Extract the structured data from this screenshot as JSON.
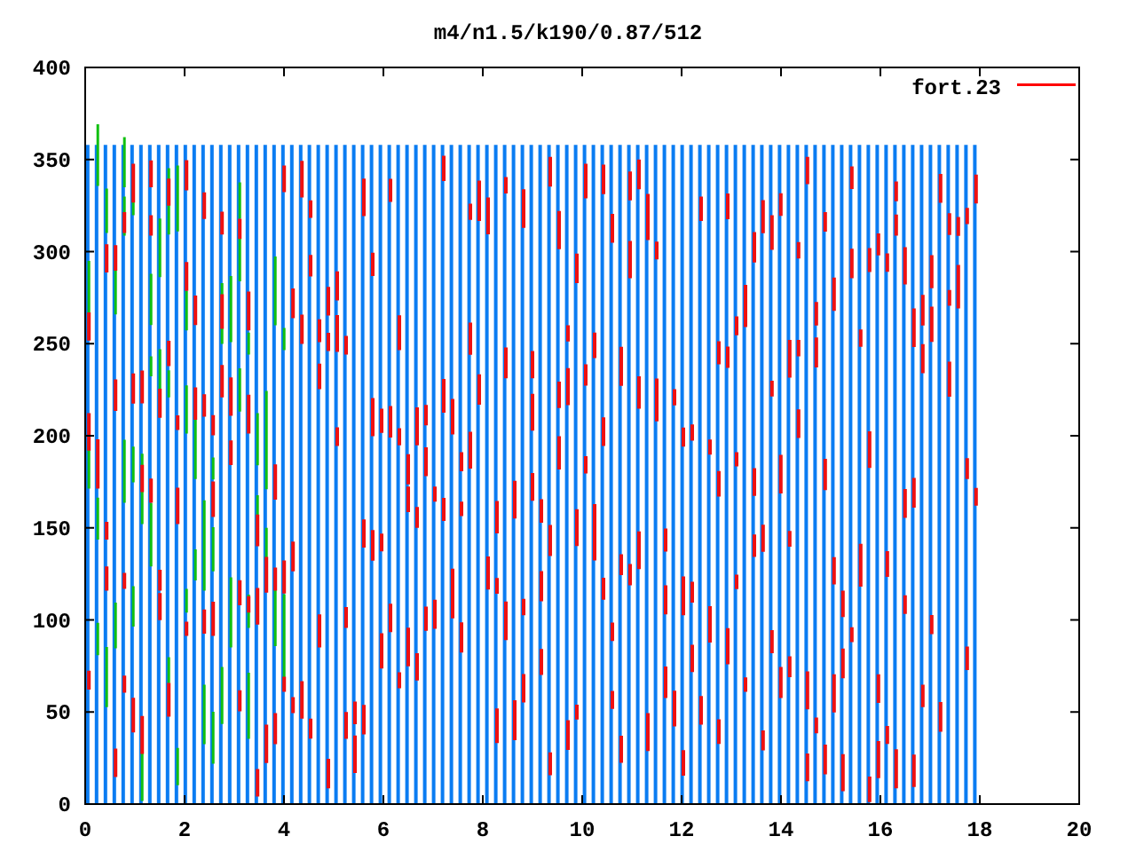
{
  "plot": {
    "title": "m4/n1.5/k190/0.87/512",
    "xticks": [
      "0",
      "2",
      "4",
      "6",
      "8",
      "10",
      "12",
      "14",
      "16",
      "18",
      "20"
    ],
    "yticks": [
      "400",
      "350",
      "300",
      "250",
      "200",
      "150",
      "100",
      "50",
      "0"
    ],
    "legend": {
      "label": "fort.23",
      "color": "#ff0000"
    }
  }
}
